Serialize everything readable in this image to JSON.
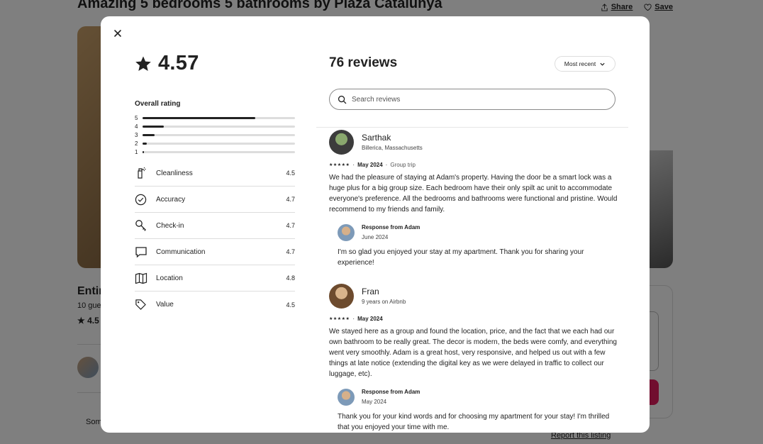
{
  "background": {
    "listing_title": "Amazing 5 bedrooms 5 bathrooms by Plaza Catalunya",
    "share_label": "Share",
    "save_label": "Save",
    "entire_text": "Entir",
    "guests_text": "10 gue",
    "rating_text": "4.5",
    "some_text": "Som",
    "report_label": "Report this listing"
  },
  "modal": {
    "overall_score": "4.57",
    "overall_label": "Overall rating",
    "distribution": [
      {
        "stars": "5",
        "fraction": 0.74
      },
      {
        "stars": "4",
        "fraction": 0.14
      },
      {
        "stars": "3",
        "fraction": 0.08
      },
      {
        "stars": "2",
        "fraction": 0.03
      },
      {
        "stars": "1",
        "fraction": 0.01
      }
    ],
    "categories": [
      {
        "icon": "spray-bottle-icon",
        "label": "Cleanliness",
        "value": "4.5"
      },
      {
        "icon": "check-circle-icon",
        "label": "Accuracy",
        "value": "4.7"
      },
      {
        "icon": "key-icon",
        "label": "Check-in",
        "value": "4.7"
      },
      {
        "icon": "chat-bubble-icon",
        "label": "Communication",
        "value": "4.7"
      },
      {
        "icon": "map-icon",
        "label": "Location",
        "value": "4.8"
      },
      {
        "icon": "tag-icon",
        "label": "Value",
        "value": "4.5"
      }
    ],
    "reviews_count": "76 reviews",
    "sort_label": "Most recent",
    "search_placeholder": "Search reviews",
    "reviews": [
      {
        "name": "Sarthak",
        "location": "Billerica, Massachusetts",
        "stars": "★★★★★",
        "date": "May 2024",
        "trip": "Group trip",
        "text": "We had the pleasure of staying at Adam's property. Having the door be a smart lock was a huge plus for a big group size. Each bedroom have their only spilt ac unit to accommodate everyone's preference. All the bedrooms and bathrooms were functional and pristine. Would recommend to my friends and family.",
        "response_from": "Response from Adam",
        "response_date": "June 2024",
        "response_text": "I'm so glad you enjoyed your stay at my apartment. Thank you for sharing your experience!"
      },
      {
        "name": "Fran",
        "location": "9 years on Airbnb",
        "stars": "★★★★★",
        "date": "May 2024",
        "trip": "",
        "text": "We stayed here as a group and found the location, price, and the fact that we each had our own bathroom to be really great. The decor is modern, the beds were comfy, and everything went very smoothly. Adam is a great host, very responsive, and helped us out with a few things at late notice (extending the digital key as we were delayed in traffic to collect our luggage, etc).",
        "response_from": "Response from Adam",
        "response_date": "May 2024",
        "response_text": "Thank you for your kind words and for choosing my apartment for your stay! I'm thrilled that you enjoyed your time with me."
      }
    ]
  }
}
